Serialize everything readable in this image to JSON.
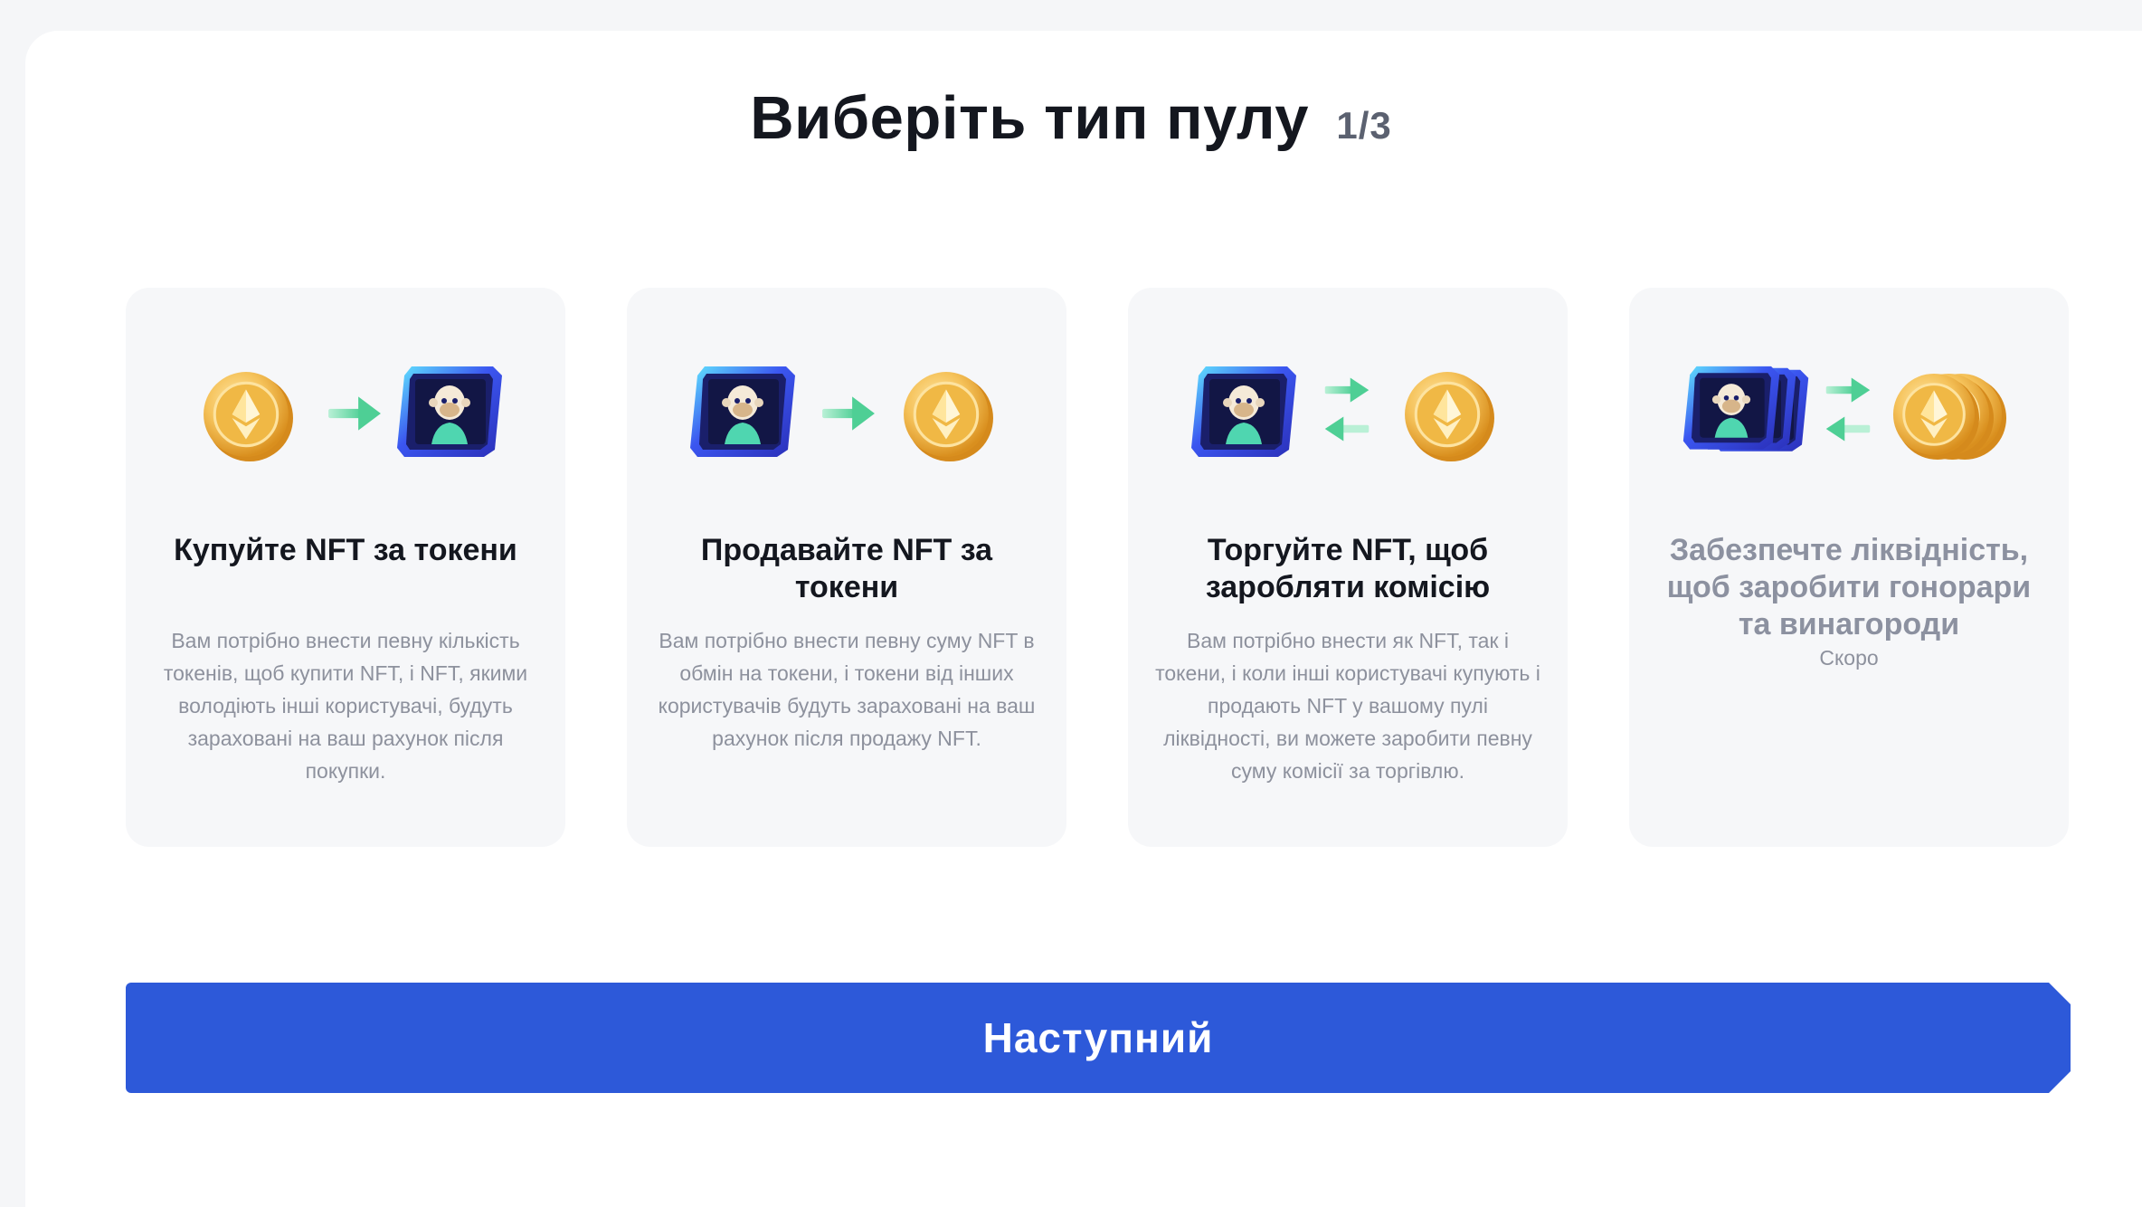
{
  "header": {
    "title": "Виберіть тип пулу",
    "step": "1/3"
  },
  "cards": [
    {
      "title": "Купуйте NFT за токени",
      "description": "Вам потрібно внести певну кількість токенів, щоб купити NFT, і NFT, якими володіють інші користувачі, будуть зараховані на ваш рахунок після покупки.",
      "icons": [
        "coin-icon",
        "arrow-right-icon",
        "nft-card-icon"
      ]
    },
    {
      "title": "Продавайте NFT за токени",
      "description": "Вам потрібно внести певну суму NFT в обмін на токени, і токени від інших користувачів будуть зараховані на ваш рахунок після продажу NFT.",
      "icons": [
        "nft-card-icon",
        "arrow-right-icon",
        "coin-icon"
      ]
    },
    {
      "title": "Торгуйте NFT, щоб заробляти комісію",
      "description": "Вам потрібно внести як NFT, так і токени, і коли інші користувачі купують і продають NFT у вашому пулі ліквідності, ви можете заробити певну суму комісії за торгівлю.",
      "icons": [
        "nft-card-icon",
        "swap-arrows-icon",
        "coin-icon"
      ]
    },
    {
      "title": "Забезпечте ліквідність, щоб заробити гонорари та винагороди",
      "status": "Скоро",
      "icons": [
        "nft-stack-icon",
        "swap-arrows-icon",
        "coin-stack-icon"
      ]
    }
  ],
  "footer": {
    "next_label": "Наступний"
  },
  "colors": {
    "accent": "#2d59d9",
    "arrow": "#5fd3a0",
    "coin": "#f2b845",
    "nft_frame": "#2f49e0"
  }
}
